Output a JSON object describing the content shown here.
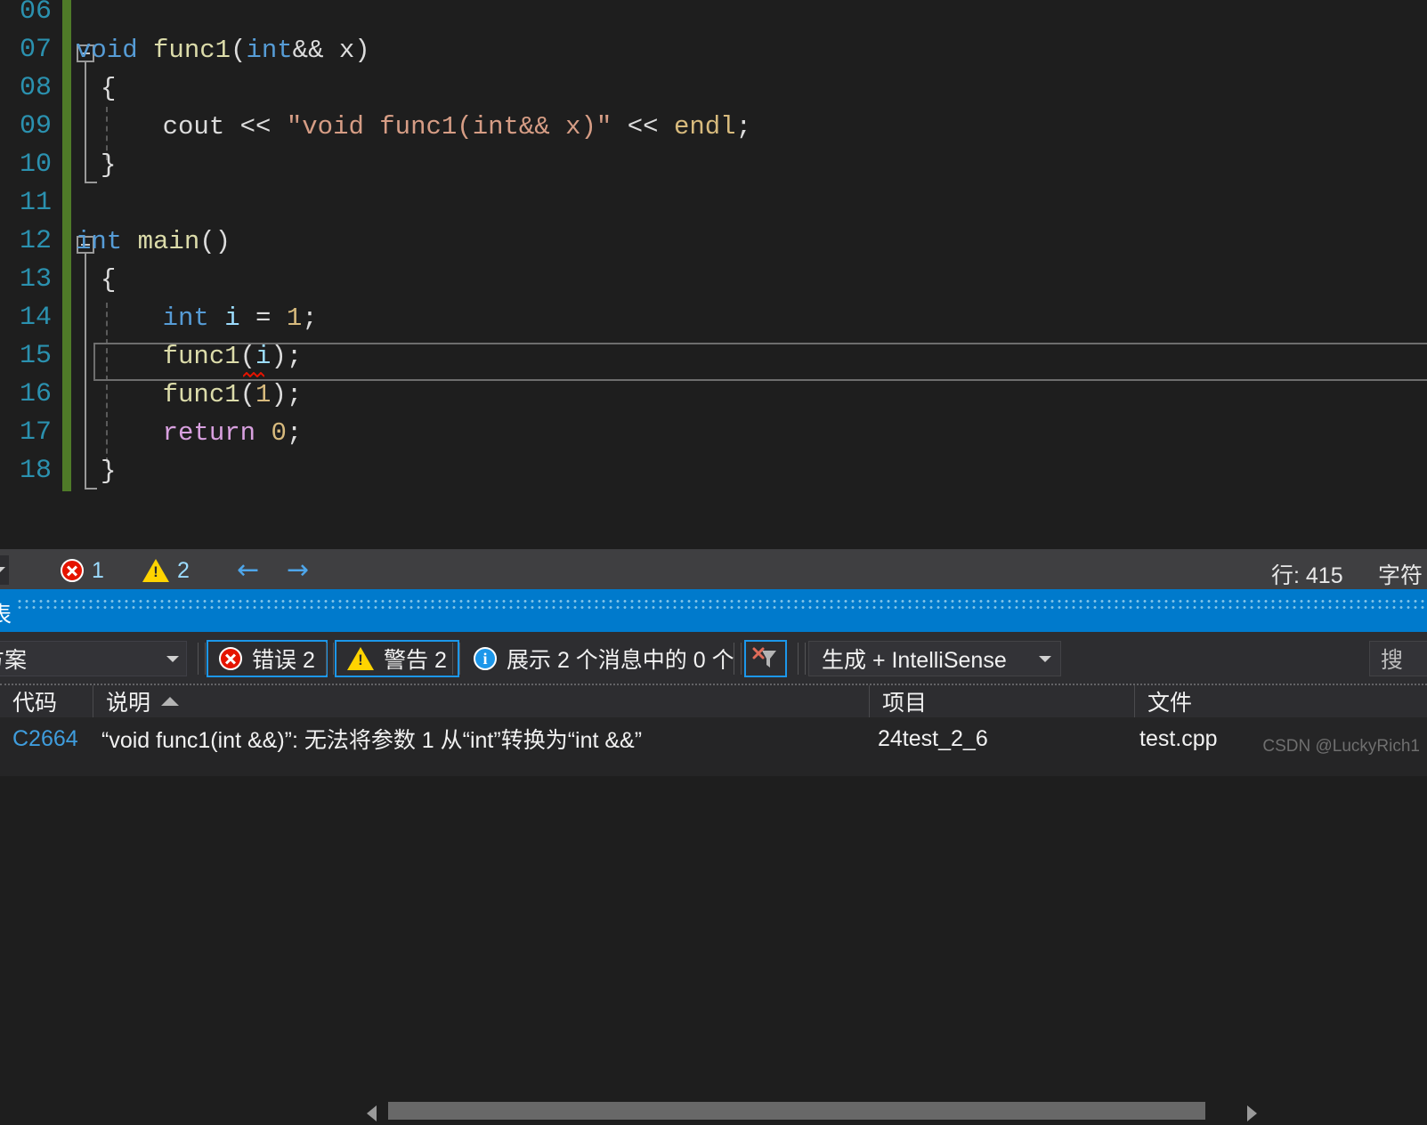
{
  "editor": {
    "line_numbers": [
      "06",
      "07",
      "08",
      "09",
      "10",
      "11",
      "12",
      "13",
      "14",
      "15",
      "16",
      "17",
      "18"
    ],
    "lines": [
      {
        "n": "06",
        "tokens": []
      },
      {
        "n": "07",
        "tokens": [
          {
            "t": "void",
            "c": "kw"
          },
          {
            "t": " ",
            "c": "plain"
          },
          {
            "t": "func1",
            "c": "fn"
          },
          {
            "t": "(",
            "c": "punct"
          },
          {
            "t": "int",
            "c": "kw"
          },
          {
            "t": "&& ",
            "c": "plain"
          },
          {
            "t": "x",
            "c": "plain"
          },
          {
            "t": ")",
            "c": "punct"
          }
        ]
      },
      {
        "n": "08",
        "tokens": [
          {
            "t": "{",
            "c": "plain"
          }
        ]
      },
      {
        "n": "09",
        "tokens": [
          {
            "t": "    cout ",
            "c": "plain"
          },
          {
            "t": "<< ",
            "c": "plain"
          },
          {
            "t": "\"void func1(int&& x)\"",
            "c": "str"
          },
          {
            "t": " << ",
            "c": "plain"
          },
          {
            "t": "endl",
            "c": "num"
          },
          {
            "t": ";",
            "c": "plain"
          }
        ]
      },
      {
        "n": "10",
        "tokens": [
          {
            "t": "}",
            "c": "plain"
          }
        ]
      },
      {
        "n": "11",
        "tokens": []
      },
      {
        "n": "12",
        "tokens": [
          {
            "t": "int",
            "c": "kw"
          },
          {
            "t": " ",
            "c": "plain"
          },
          {
            "t": "main",
            "c": "fn"
          },
          {
            "t": "()",
            "c": "punct"
          }
        ]
      },
      {
        "n": "13",
        "tokens": [
          {
            "t": "{",
            "c": "plain"
          }
        ]
      },
      {
        "n": "14",
        "tokens": [
          {
            "t": "    ",
            "c": "plain"
          },
          {
            "t": "int",
            "c": "kw"
          },
          {
            "t": " ",
            "c": "plain"
          },
          {
            "t": "i",
            "c": "id"
          },
          {
            "t": " = ",
            "c": "plain"
          },
          {
            "t": "1",
            "c": "num"
          },
          {
            "t": ";",
            "c": "plain"
          }
        ]
      },
      {
        "n": "15",
        "tokens": [
          {
            "t": "    ",
            "c": "plain"
          },
          {
            "t": "func1",
            "c": "fn"
          },
          {
            "t": "(",
            "c": "punct"
          },
          {
            "t": "i",
            "c": "id"
          },
          {
            "t": ")",
            "c": "punct"
          },
          {
            "t": ";",
            "c": "plain"
          }
        ]
      },
      {
        "n": "16",
        "tokens": [
          {
            "t": "    ",
            "c": "plain"
          },
          {
            "t": "func1",
            "c": "fn"
          },
          {
            "t": "(",
            "c": "punct"
          },
          {
            "t": "1",
            "c": "num"
          },
          {
            "t": ")",
            "c": "punct"
          },
          {
            "t": ";",
            "c": "plain"
          }
        ]
      },
      {
        "n": "17",
        "tokens": [
          {
            "t": "    ",
            "c": "plain"
          },
          {
            "t": "return",
            "c": "ctl"
          },
          {
            "t": " ",
            "c": "plain"
          },
          {
            "t": "0",
            "c": "num"
          },
          {
            "t": ";",
            "c": "plain"
          }
        ]
      },
      {
        "n": "18",
        "tokens": [
          {
            "t": "}",
            "c": "plain"
          }
        ]
      }
    ]
  },
  "statusbar": {
    "error_count": "1",
    "warning_count": "2",
    "prev_label": "←",
    "next_label": "→",
    "line_label": "行: 415",
    "char_label": "字符"
  },
  "panel": {
    "title": "表"
  },
  "toolbar": {
    "scope_value": "决方案",
    "errors_label": "错误 2",
    "warnings_label": "警告 2",
    "messages_label": "展示 2 个消息中的 0 个",
    "build_filter_value": "生成 + IntelliSense",
    "search_placeholder": "搜"
  },
  "table": {
    "columns": [
      {
        "label": "代码"
      },
      {
        "label": "说明"
      },
      {
        "label": "项目"
      },
      {
        "label": "文件"
      }
    ],
    "rows": [
      {
        "code": "C2664",
        "description": "“void func1(int &&)”: 无法将参数 1 从“int”转换为“int &&”",
        "project": "24test_2_6",
        "file": "test.cpp"
      }
    ]
  },
  "watermark": "CSDN @LuckyRich1",
  "colors": {
    "editor_bg": "#1e1e1e",
    "accent_blue": "#007acc",
    "error_red": "#e51400",
    "warning_yellow": "#ffd400",
    "changebar_green": "#4f7a28",
    "linenum_cyan": "#2b91af"
  }
}
